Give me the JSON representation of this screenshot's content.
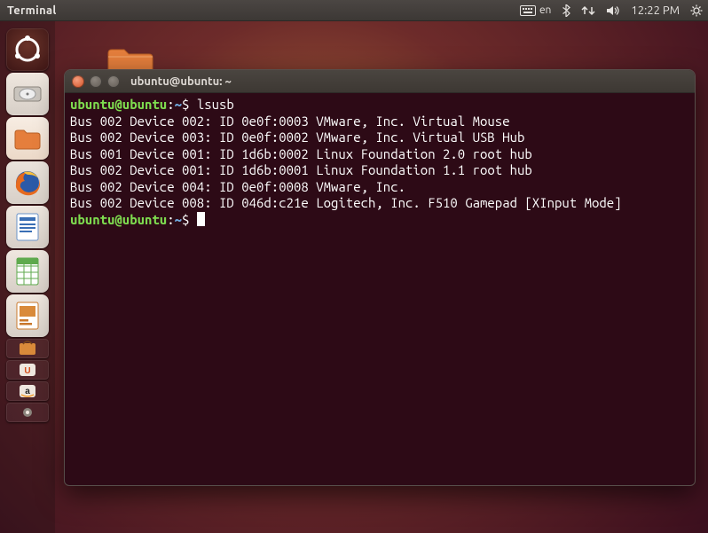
{
  "toppanel": {
    "app_name": "Terminal",
    "lang": "en",
    "time": "12:22 PM"
  },
  "launcher": {
    "items": [
      {
        "name": "dash-home"
      },
      {
        "name": "disk-utility"
      },
      {
        "name": "files"
      },
      {
        "name": "firefox"
      },
      {
        "name": "writer"
      },
      {
        "name": "calc"
      },
      {
        "name": "impress"
      },
      {
        "name": "software-center"
      },
      {
        "name": "ubuntu-one"
      },
      {
        "name": "amazon"
      },
      {
        "name": "system-settings"
      }
    ]
  },
  "window": {
    "title": "ubuntu@ubuntu: ~"
  },
  "terminal": {
    "prompt_user": "ubuntu@ubuntu",
    "prompt_sep": ":",
    "prompt_path": "~",
    "prompt_tail": "$ ",
    "command": "lsusb",
    "lines": [
      "Bus 002 Device 002: ID 0e0f:0003 VMware, Inc. Virtual Mouse",
      "Bus 002 Device 003: ID 0e0f:0002 VMware, Inc. Virtual USB Hub",
      "Bus 001 Device 001: ID 1d6b:0002 Linux Foundation 2.0 root hub",
      "Bus 002 Device 001: ID 1d6b:0001 Linux Foundation 1.1 root hub",
      "Bus 002 Device 004: ID 0e0f:0008 VMware, Inc. ",
      "Bus 002 Device 008: ID 046d:c21e Logitech, Inc. F510 Gamepad [XInput Mode]"
    ]
  }
}
